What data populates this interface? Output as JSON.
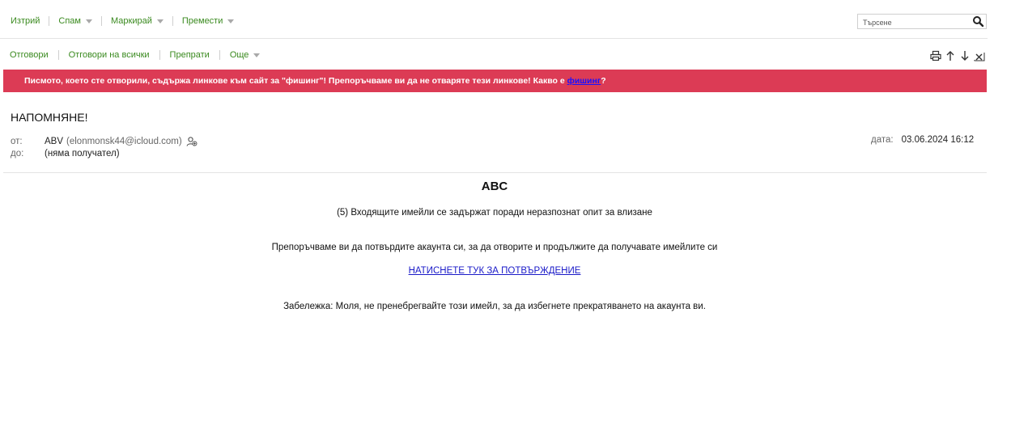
{
  "toolbar_top": {
    "delete_label": "Изтрий",
    "spam_label": "Спам",
    "mark_label": "Маркирай",
    "move_label": "Премести",
    "search_placeholder": "Търсене"
  },
  "toolbar_message": {
    "reply_label": "Отговори",
    "reply_all_label": "Отговори на всички",
    "forward_label": "Препрати",
    "more_label": "Още",
    "icons": [
      "print-icon",
      "previous-message-icon",
      "next-message-icon",
      "close-icon"
    ]
  },
  "warning": {
    "text": "Писмото, което сте отворили, съдържа линкове към сайт за \"фишинг\"! Препоръчваме ви да не отваряте тези линкове! Какво е ",
    "link": "фишинг",
    "suffix": "?",
    "background": "#dc3b55"
  },
  "message": {
    "subject": "НАПОМНЯНЕ!",
    "from_label": "от:",
    "from_name": "ABV",
    "from_address": "(elonmonsk44@icloud.com)",
    "to_label": "до:",
    "to_value": "(няма получател)",
    "date_label": "дата:",
    "date_value": "03.06.2024 16:12"
  },
  "body": {
    "brand": "ABC",
    "line1": "(5) Входящите имейли се задържат поради неразпознат опит за влизане",
    "line2": "Препоръчваме ви да потвърдите акаунта си, за да отворите и продължите да получавате имейлите си",
    "cta": "НАТИСНЕТЕ ТУК ЗА ПОТВЪРЖДЕНИЕ",
    "note": "Забележка: Моля, не пренебрегвайте този имейл, за да избегнете прекратяването на акаунта ви."
  },
  "colors": {
    "accent_green": "#3a8a1f",
    "warning_red": "#dc3b55",
    "link_blue": "#1a1ac8"
  }
}
